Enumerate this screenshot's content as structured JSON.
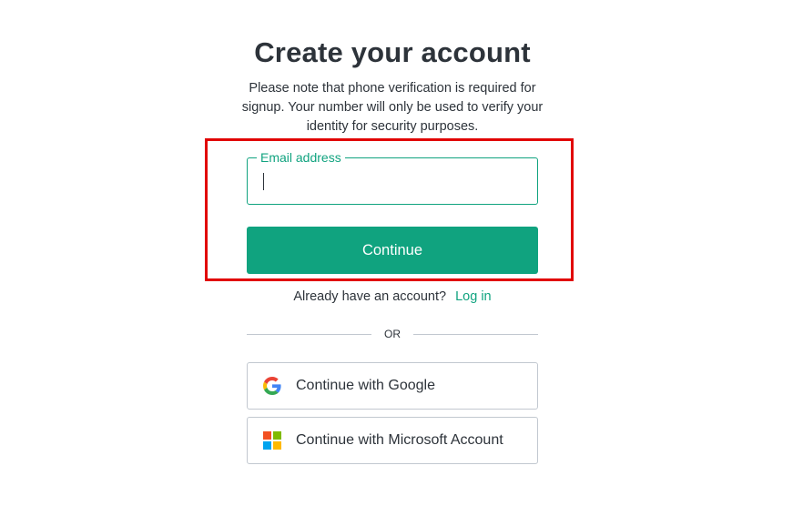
{
  "header": {
    "title": "Create your account",
    "subtitle": "Please note that phone verification is required for signup. Your number will only be used to verify your identity for security purposes."
  },
  "form": {
    "email_label": "Email address",
    "email_value": "",
    "continue_label": "Continue"
  },
  "login": {
    "prompt": "Already have an account?",
    "link_label": "Log in"
  },
  "divider": {
    "label": "OR"
  },
  "social": {
    "google_label": "Continue with Google",
    "microsoft_label": "Continue with Microsoft Account"
  },
  "colors": {
    "accent": "#10a37f",
    "highlight": "#e10000",
    "google_blue": "#4285F4",
    "google_red": "#EA4335",
    "google_yellow": "#FBBC05",
    "google_green": "#34A853",
    "ms_red": "#F25022",
    "ms_green": "#7FBA00",
    "ms_blue": "#00A4EF",
    "ms_yellow": "#FFB900"
  },
  "icons": {
    "google": "google-logo-icon",
    "microsoft": "microsoft-logo-icon"
  }
}
